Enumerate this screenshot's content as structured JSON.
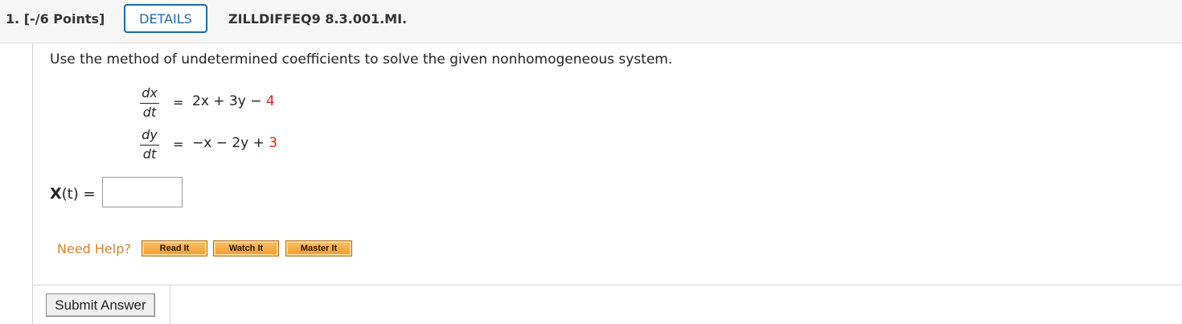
{
  "header": {
    "question_points": "1. [-/6 Points]",
    "details_label": "DETAILS",
    "problem_id": "ZILLDIFFEQ9 8.3.001.MI."
  },
  "problem": {
    "instruction": "Use the method of undetermined coefficients to solve the given nonhomogeneous system.",
    "eq1": {
      "num": "dx",
      "den": "dt",
      "equals": "=",
      "rhs_terms": "2x + 3y − ",
      "rhs_const": "4"
    },
    "eq2": {
      "num": "dy",
      "den": "dt",
      "equals": "=",
      "rhs_terms": "−x − 2y + ",
      "rhs_const": "3"
    }
  },
  "answer": {
    "label_bold": "X",
    "label_rest": "(t) =",
    "value": ""
  },
  "help": {
    "need_help": "Need Help?",
    "buttons": [
      "Read It",
      "Watch It",
      "Master It"
    ]
  },
  "footer": {
    "submit_label": "Submit Answer"
  },
  "colors": {
    "details_blue": "#1e66a6",
    "need_help_orange": "#d9822b",
    "constant_red": "#d42a1f",
    "help_button_orange": "#f09c2e"
  }
}
